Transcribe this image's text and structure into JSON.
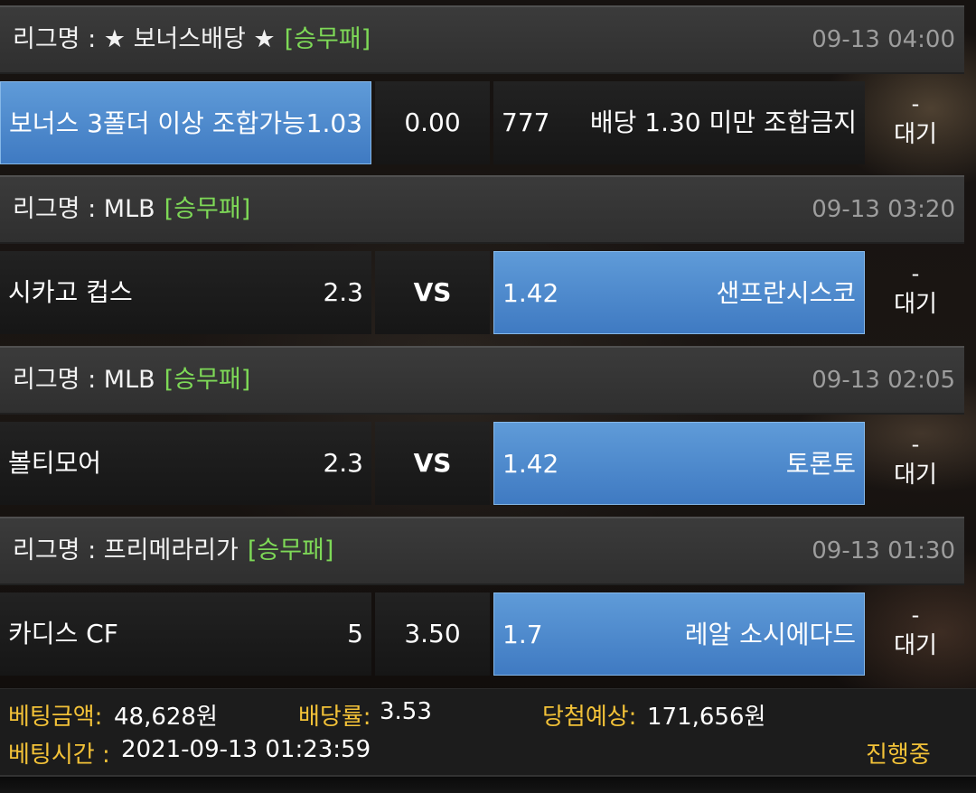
{
  "bets": [
    {
      "league_prefix": "리그명 : ",
      "league": "★ 보너스배당 ★",
      "bet_type": "[승무패]",
      "datetime": "09-13 04:00",
      "home": "보너스 3폴더 이상 조합가능",
      "home_odd": "1.03",
      "middle": "0.00",
      "away_odd": "777",
      "away": "배당 1.30 미만 조합금지",
      "selected": "home",
      "status_dash": "-",
      "status": "대기"
    },
    {
      "league_prefix": "리그명 : ",
      "league": "MLB",
      "bet_type": "[승무패]",
      "datetime": "09-13 03:20",
      "home": "시카고 컵스",
      "home_odd": "2.3",
      "middle": "VS",
      "away_odd": "1.42",
      "away": "샌프란시스코",
      "selected": "away",
      "status_dash": "-",
      "status": "대기"
    },
    {
      "league_prefix": "리그명 : ",
      "league": "MLB",
      "bet_type": "[승무패]",
      "datetime": "09-13 02:05",
      "home": "볼티모어",
      "home_odd": "2.3",
      "middle": "VS",
      "away_odd": "1.42",
      "away": "토론토",
      "selected": "away",
      "status_dash": "-",
      "status": "대기"
    },
    {
      "league_prefix": "리그명 : ",
      "league": "프리메라리가",
      "bet_type": "[승무패]",
      "datetime": "09-13 01:30",
      "home": "카디스 CF",
      "home_odd": "5",
      "middle": "3.50",
      "away_odd": "1.7",
      "away": "레알 소시에다드",
      "selected": "away",
      "status_dash": "-",
      "status": "대기"
    }
  ],
  "summary": {
    "bet_amount_label": "베팅금액:",
    "bet_amount": "48,628원",
    "odds_label": "배당률:",
    "odds": "3.53",
    "expected_label": "당첨예상:",
    "expected": "171,656원",
    "bet_time_label": "베팅시간 :",
    "bet_time": "2021-09-13 01:23:59",
    "progress": "진행중"
  },
  "colors": {
    "selected_blue": "#4a86cc",
    "bet_type_green": "#7ed957",
    "summary_label_yellow": "#f3c238"
  }
}
